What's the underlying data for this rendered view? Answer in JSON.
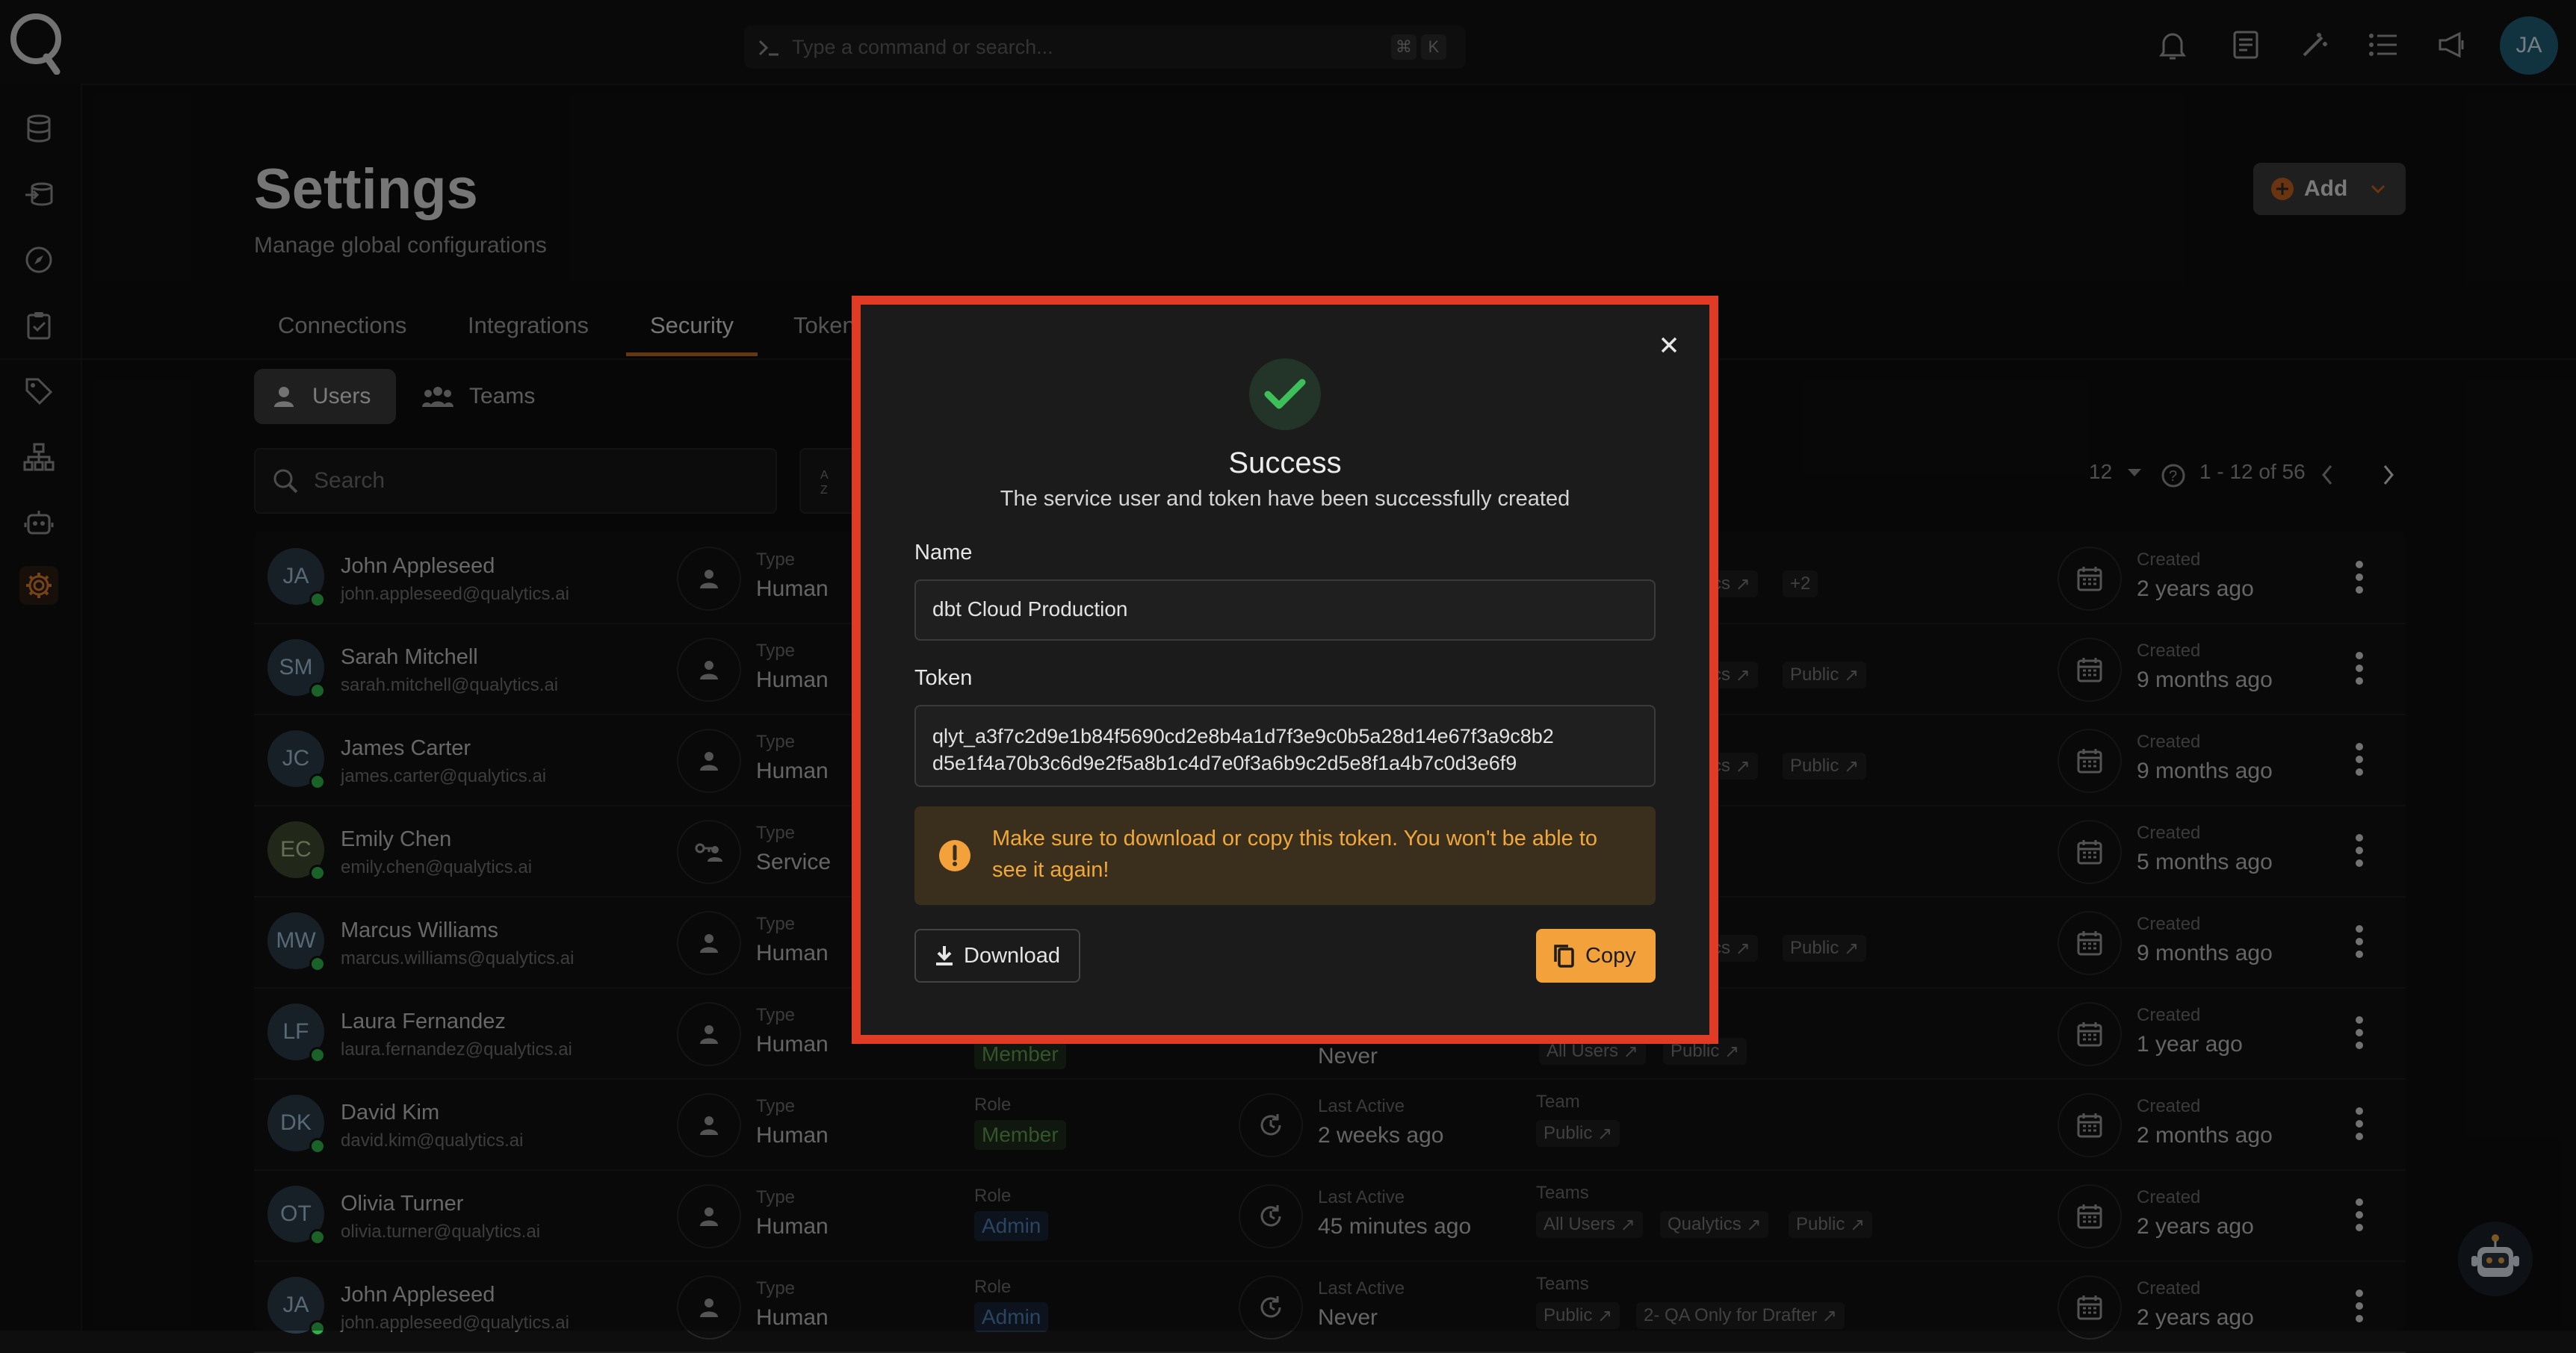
{
  "topbar": {
    "command_placeholder": "Type a command or search...",
    "shortcut_keys": [
      "⌘",
      "K"
    ],
    "icons": [
      "bell-icon",
      "document-icon",
      "magic-wand-icon",
      "list-icon",
      "megaphone-icon"
    ],
    "user_initials": "JA"
  },
  "sidebar": {
    "items": [
      "database-icon",
      "data-flow-icon",
      "compass-icon",
      "checklist-icon",
      "tag-icon",
      "hierarchy-icon",
      "robot-icon",
      "settings-icon"
    ],
    "active": "settings-icon"
  },
  "page": {
    "title": "Settings",
    "subtitle": "Manage global configurations",
    "add_label": "Add"
  },
  "tabs": [
    {
      "label": "Connections",
      "active": false
    },
    {
      "label": "Integrations",
      "active": false
    },
    {
      "label": "Security",
      "active": true
    },
    {
      "label": "Token",
      "active": false
    }
  ],
  "segments": {
    "users": "Users",
    "teams": "Teams"
  },
  "search": {
    "placeholder": "Search"
  },
  "pagination": {
    "page_size": "12",
    "range": "1 - 12 of 56"
  },
  "users": [
    {
      "initials": "JA",
      "name": "John Appleseed",
      "email": "john.appleseed@qualytics.ai",
      "type_label": "Type",
      "type": "Human",
      "teams_visible": [
        "tics",
        "+2"
      ],
      "created_label": "Created",
      "created": "2 years ago"
    },
    {
      "initials": "SM",
      "name": "Sarah Mitchell",
      "email": "sarah.mitchell@qualytics.ai",
      "type_label": "Type",
      "type": "Human",
      "teams_visible": [
        "tics",
        "Public"
      ],
      "created_label": "Created",
      "created": "9 months ago"
    },
    {
      "initials": "JC",
      "name": "James Carter",
      "email": "james.carter@qualytics.ai",
      "type_label": "Type",
      "type": "Human",
      "teams_visible": [
        "tics",
        "Public"
      ],
      "created_label": "Created",
      "created": "9 months ago"
    },
    {
      "initials": "EC",
      "name": "Emily Chen",
      "email": "emily.chen@qualytics.ai",
      "type_label": "Type",
      "type": "Service",
      "teams_visible": [],
      "created_label": "Created",
      "created": "5 months ago"
    },
    {
      "initials": "MW",
      "name": "Marcus Williams",
      "email": "marcus.williams@qualytics.ai",
      "type_label": "Type",
      "type": "Human",
      "teams_visible": [
        "tics",
        "Public"
      ],
      "created_label": "Created",
      "created": "9 months ago"
    },
    {
      "initials": "LF",
      "name": "Laura Fernandez",
      "email": "laura.fernandez@qualytics.ai",
      "type_label": "Type",
      "type": "Human",
      "role": "Member",
      "last_active": "Never",
      "teams_visible": [
        "All Users",
        "Public"
      ],
      "created_label": "Created",
      "created": "1 year ago"
    },
    {
      "initials": "DK",
      "name": "David Kim",
      "email": "david.kim@qualytics.ai",
      "type_label": "Type",
      "type": "Human",
      "role_label": "Role",
      "role": "Member",
      "last_active_label": "Last Active",
      "last_active": "2 weeks ago",
      "teams_label": "Team",
      "teams_visible": [
        "Public"
      ],
      "created_label": "Created",
      "created": "2 months ago"
    },
    {
      "initials": "OT",
      "name": "Olivia Turner",
      "email": "olivia.turner@qualytics.ai",
      "type_label": "Type",
      "type": "Human",
      "role_label": "Role",
      "role": "Admin",
      "last_active_label": "Last Active",
      "last_active": "45 minutes ago",
      "teams_label": "Teams",
      "teams_visible": [
        "All Users",
        "Qualytics",
        "Public"
      ],
      "created_label": "Created",
      "created": "2 years ago"
    },
    {
      "initials": "JA",
      "name": "John Appleseed",
      "email": "john.appleseed@qualytics.ai",
      "type_label": "Type",
      "type": "Human",
      "role_label": "Role",
      "role": "Admin",
      "last_active_label": "Last Active",
      "last_active": "Never",
      "teams_label": "Teams",
      "teams_visible": [
        "Public",
        "2- QA Only for Drafter"
      ],
      "created_label": "Created",
      "created": "2 years ago"
    }
  ],
  "modal": {
    "title": "Success",
    "subtitle": "The service user and token have been successfully created",
    "name_label": "Name",
    "name_value": "dbt Cloud Production",
    "token_label": "Token",
    "token_line1": "qlyt_a3f7c2d9e1b84f5690cd2e8b4a1d7f3e9c0b5a28d14e67f3a9c8b2",
    "token_line2": "d5e1f4a70b3c6d9e2f5a8b1c4d7e0f3a6b9c2d5e8f1a4b7c0d3e6f9",
    "warning": "Make sure to download or copy this token. You won't be able to see it again!",
    "download_label": "Download",
    "copy_label": "Copy",
    "highlight_color": "#e03b24",
    "accent_color": "#f3a13a",
    "success_color": "#3fbf5a"
  }
}
